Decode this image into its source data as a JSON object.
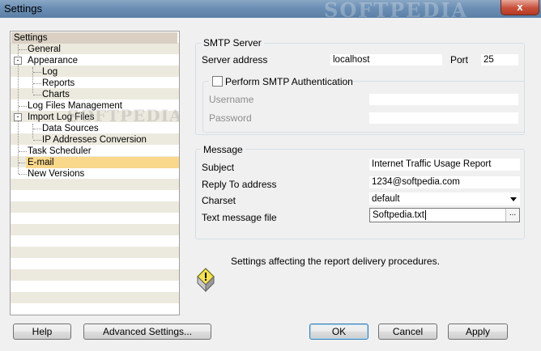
{
  "window": {
    "title": "Settings",
    "close_glyph": "x",
    "watermark": "SOFTPEDIA"
  },
  "nav": {
    "root": "Settings",
    "items": [
      {
        "label": "General"
      },
      {
        "label": "Appearance",
        "toggle": "-"
      },
      {
        "label": "Log"
      },
      {
        "label": "Reports"
      },
      {
        "label": "Charts"
      },
      {
        "label": "Log Files Management"
      },
      {
        "label": "Import Log Files",
        "toggle": "-"
      },
      {
        "label": "Data Sources"
      },
      {
        "label": "IP Addresses Conversion"
      },
      {
        "label": "Task Scheduler"
      },
      {
        "label": "E-mail",
        "selected": true
      },
      {
        "label": "New Versions"
      }
    ],
    "watermark": "SOFTPEDIA"
  },
  "smtp": {
    "group_title": "SMTP Server",
    "server_label": "Server address",
    "server_value": "localhost",
    "port_label": "Port",
    "port_value": "25",
    "auth_label": "Perform SMTP Authentication",
    "auth_checked": false,
    "username_label": "Username",
    "username_value": "",
    "password_label": "Password",
    "password_value": ""
  },
  "message": {
    "group_title": "Message",
    "subject_label": "Subject",
    "subject_value": "Internet Traffic Usage Report",
    "reply_label": "Reply To address",
    "reply_value": "1234@softpedia.com",
    "charset_label": "Charset",
    "charset_value": "default",
    "textfile_label": "Text message file",
    "textfile_value": "Softpedia.txt",
    "browse_label": "..."
  },
  "info": {
    "text": "Settings affecting the report delivery procedures.",
    "icon": "info-bulb-icon"
  },
  "buttons": {
    "help": "Help",
    "advanced": "Advanced Settings...",
    "ok": "OK",
    "cancel": "Cancel",
    "apply": "Apply"
  },
  "colors": {
    "selection": "#f9d88c",
    "root_header": "#d9d0c3",
    "stripe": "#eceade"
  }
}
